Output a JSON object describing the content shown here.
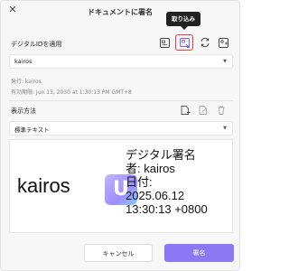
{
  "dialog": {
    "title": "ドキュメントに署名",
    "close_symbol": "✕"
  },
  "tooltip": {
    "text": "取り込み"
  },
  "digital_id": {
    "label": "デジタルIDを適用",
    "selected": "kairos",
    "issuer_line": "発行: kairos",
    "expiry_line": "有効期限: Jun 13, 2030 at 1:30:13 PM GMT+8"
  },
  "display": {
    "label": "表示方法",
    "selected": "標準テキスト"
  },
  "preview": {
    "name": "kairos",
    "logo_letter": "U",
    "lines": [
      "デジタル署名",
      "者: kairos",
      "日付:",
      "2025.06.12",
      "13:30:13 +0800"
    ]
  },
  "buttons": {
    "cancel": "キャンセル",
    "sign": "署名"
  },
  "colors": {
    "accent": "#8c78f2",
    "highlight": "#e84040",
    "tooltip_bg": "#222222"
  }
}
